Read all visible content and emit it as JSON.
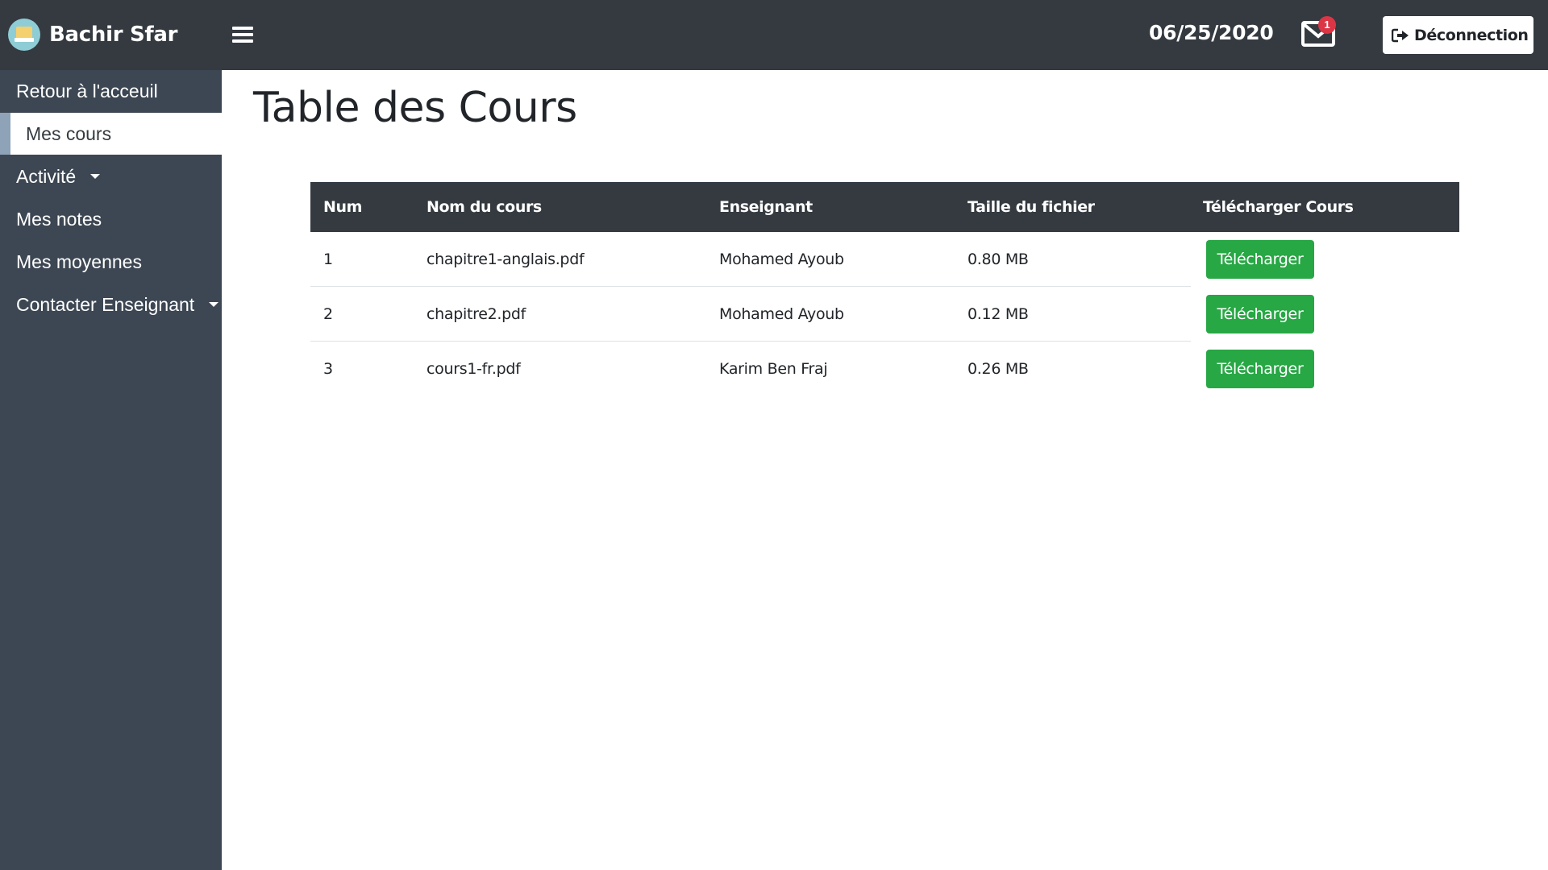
{
  "header": {
    "user_name": "Bachir Sfar",
    "date": "06/25/2020",
    "mail_badge": "1",
    "logout_label": "Déconnection",
    "icons": [
      "avatar",
      "hamburger-icon",
      "mail-icon",
      "logout-icon"
    ]
  },
  "sidebar": {
    "items": [
      {
        "label": "Retour à l'acceuil"
      },
      {
        "label": "Mes cours",
        "active": true
      },
      {
        "label": "Activité",
        "dropdown": true
      },
      {
        "label": "Mes notes"
      },
      {
        "label": "Mes moyennes"
      },
      {
        "label": "Contacter Enseignant",
        "dropdown": true
      }
    ]
  },
  "main": {
    "title": "Table des Cours",
    "table": {
      "headers": [
        "Num",
        "Nom du cours",
        "Enseignant",
        "Taille du fichier",
        "Télécharger Cours"
      ],
      "rows": [
        {
          "num": "1",
          "name": "chapitre1-anglais.pdf",
          "teacher": "Mohamed Ayoub",
          "size": "0.80 MB",
          "action": "Télécharger"
        },
        {
          "num": "2",
          "name": "chapitre2.pdf",
          "teacher": "Mohamed Ayoub",
          "size": "0.12 MB",
          "action": "Télécharger"
        },
        {
          "num": "3",
          "name": "cours1-fr.pdf",
          "teacher": "Karim Ben Fraj",
          "size": "0.26 MB",
          "action": "Télécharger"
        }
      ]
    }
  },
  "colors": {
    "topbar": "#343a40",
    "sidebar": "#3d4753",
    "active_accent": "#8ea3b8",
    "success": "#28a745",
    "badge": "#dc3545"
  }
}
